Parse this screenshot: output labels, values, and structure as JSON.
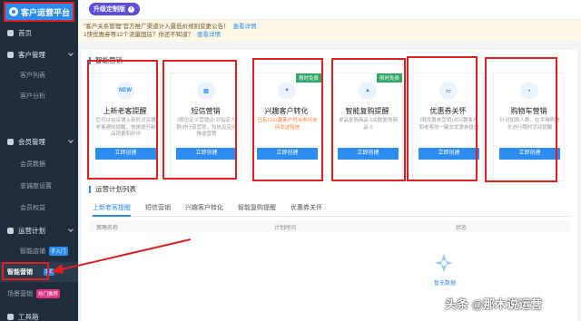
{
  "app": {
    "brand": "客户运营平台"
  },
  "sidebar": {
    "home": "首页",
    "customer_mgmt": "客户管理",
    "customer_list": "客户列表",
    "customer_analysis": "客户分析",
    "member_mgmt": "会员管理",
    "member_data": "会员数据",
    "loyalty_settings": "忠诚度设置",
    "member_benefits": "会员权益",
    "ops_plan": "运营计划",
    "smart_store": "智能店铺",
    "smart_store_badge": "手入门",
    "smart_marketing": "智能营销",
    "smart_marketing_badge": "1.0",
    "scene_marketing": "场景营销",
    "scene_marketing_badge": "热门推荐",
    "toolbox": "工具箱"
  },
  "topbar": {
    "upgrade_label": "升级定制版"
  },
  "notice": {
    "line1": "\"客户关系管理\"官方推广渠道计入最低价规则变更公告！",
    "line1_link": "查看详情",
    "line2": "1快优惠券等12个流量固店？你还不知道？",
    "line2_link": "查看详情"
  },
  "main": {
    "section_smart": "智能营销",
    "cards": [
      {
        "icon": "NEW",
        "title": "上新老客提醒",
        "desc": "您可以在店铺上新时对店铺老客通知提醒，快速提升新品销量和好评",
        "warn": false,
        "button": "立即创建",
        "tag": ""
      },
      {
        "icon": "▥",
        "title": "短信营销",
        "desc": "(限位定义营销)针对指定人群进行促营销，短信及定向推送营销",
        "warn": false,
        "button": "立即创建",
        "tag": ""
      },
      {
        "icon": "♥",
        "title": "兴趣客户转化",
        "desc": "已有12兴趣客户符合条件支持发送短信",
        "warn": true,
        "button": "立即创建",
        "tag": "限时免费"
      },
      {
        "icon": "▲",
        "title": "智能复购提醒",
        "desc": "单品复购商品 0关联复购商品 0",
        "warn": false,
        "button": "立即创建",
        "tag": "限时免费"
      },
      {
        "icon": "▭",
        "title": "优惠券关怀",
        "desc": "(限优惠券营销)对兴趣客户和老客的一键式优惠券投放",
        "warn": false,
        "button": "立即创建",
        "tag": ""
      },
      {
        "icon": "◒",
        "title": "购物车营销",
        "desc": "针对加购人群，在手淘购物车进行限时活动提醒",
        "warn": false,
        "button": "立即创建",
        "tag": ""
      }
    ],
    "section_plans": "运营计划列表",
    "tabs": [
      "上新老客提醒",
      "短信营销",
      "兴趣客户转化",
      "智能复购提醒",
      "优惠券关怀"
    ],
    "columns": [
      "策略名称",
      "计划时间",
      "状态"
    ],
    "empty_text": "暂无数据"
  },
  "watermark": "头条 @那木说运营",
  "colors": {
    "accent": "#2d8cf0",
    "sidebar": "#1f2d3d",
    "highlight": "#e02020",
    "tag_green": "#2ea865",
    "upgrade": "#5b4fd8"
  }
}
